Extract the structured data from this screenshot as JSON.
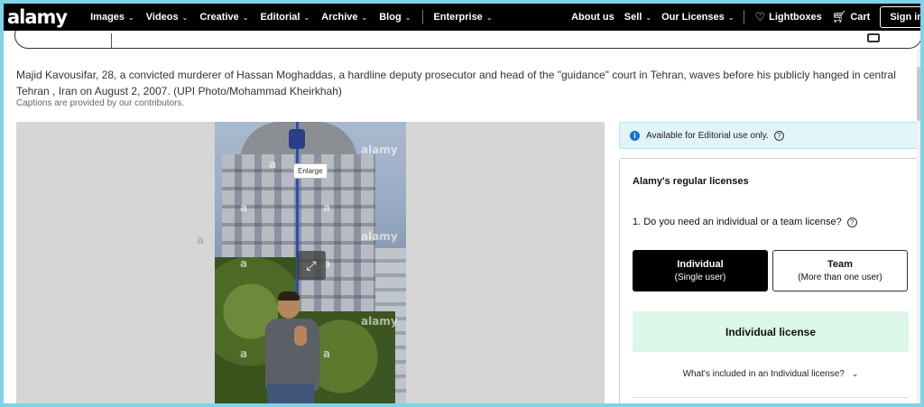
{
  "nav": {
    "logo": "alamy",
    "items": [
      {
        "label": "Images"
      },
      {
        "label": "Videos"
      },
      {
        "label": "Creative"
      },
      {
        "label": "Editorial"
      },
      {
        "label": "Archive"
      },
      {
        "label": "Blog"
      }
    ],
    "enterprise": "Enterprise",
    "about": "About us",
    "sell": "Sell",
    "licenses": "Our Licenses",
    "lightboxes": "Lightboxes",
    "cart": "Cart",
    "signin": "Sign in"
  },
  "caption": {
    "text": "Majid Kavousifar, 28, a convicted murderer of Hassan Moghaddas, a hardline deputy prosecutor and head of the \"guidance\" court in Tehran, waves before his publicly hanged in central Tehran , Iran on August 2, 2007. (UPI Photo/Mohammad Kheirkhah)",
    "note": "Captions are provided by our contributors."
  },
  "image": {
    "watermark": "alamy",
    "watermark_letter": "a",
    "enlarge_tooltip": "Enlarge",
    "expand_symbol": "⤢"
  },
  "editorial": {
    "text": "Available for Editorial use only."
  },
  "license": {
    "title": "Alamy's regular licenses",
    "question": "1.  Do you need an individual or a team license?",
    "options": [
      {
        "title": "Individual",
        "subtitle": "(Single user)"
      },
      {
        "title": "Team",
        "subtitle": "(More than one user)"
      }
    ],
    "cta": "Individual license",
    "included": "What's included in an Individual license?"
  }
}
